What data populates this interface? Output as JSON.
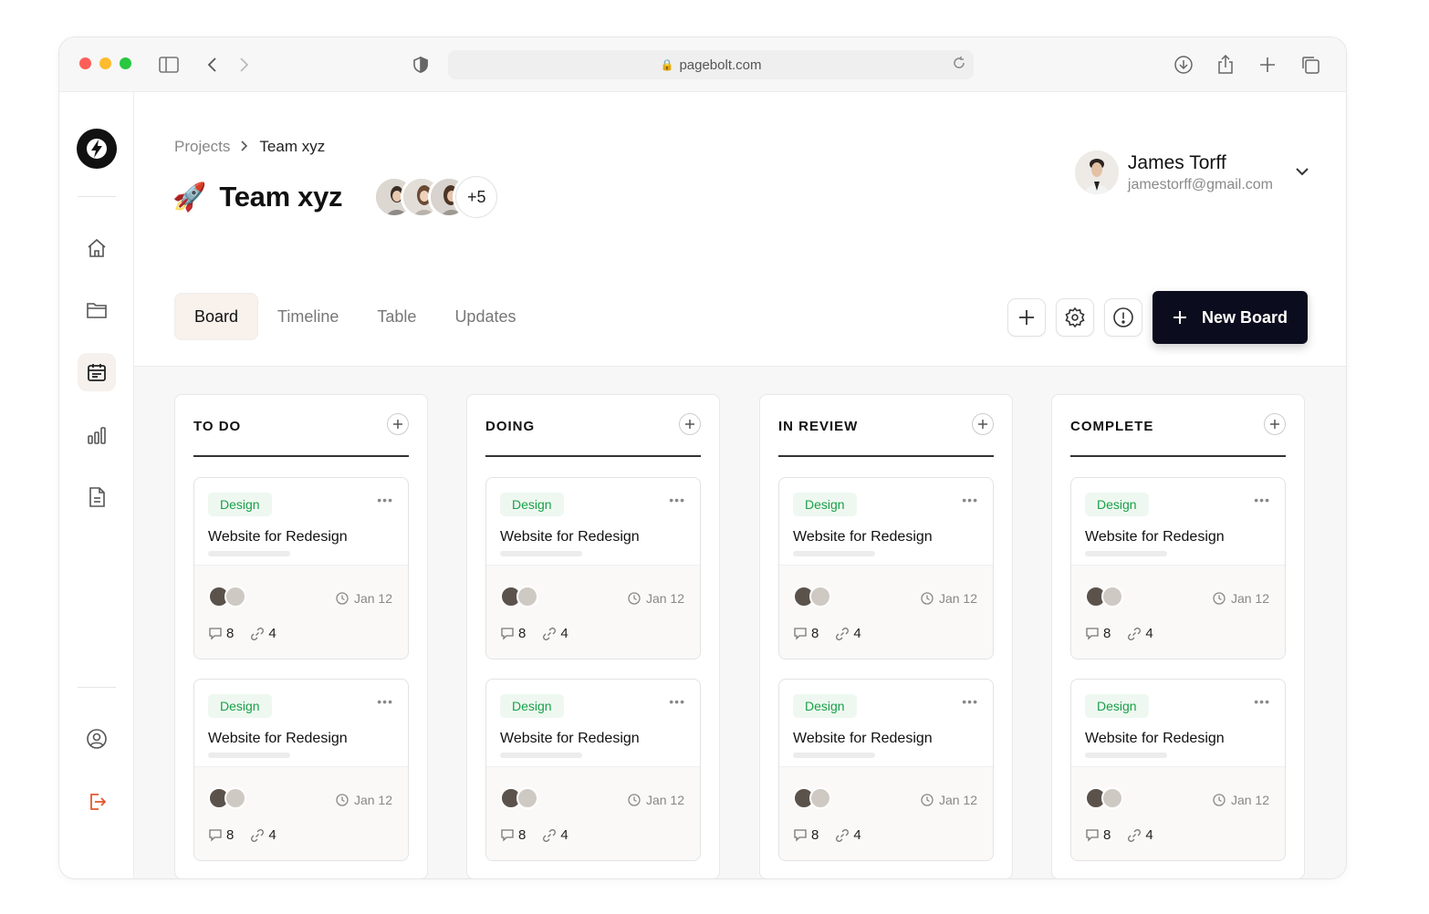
{
  "browser": {
    "url": "pagebolt.com"
  },
  "breadcrumb": {
    "parent": "Projects",
    "separator": ">",
    "current": "Team xyz"
  },
  "page": {
    "emoji": "🚀",
    "title": "Team xyz",
    "members_more": "+5"
  },
  "user": {
    "name": "James Torff",
    "email": "jamestorff@gmail.com"
  },
  "tabs": [
    "Board",
    "Timeline",
    "Table",
    "Updates"
  ],
  "toolbar": {
    "new_board_label": "New Board"
  },
  "columns": [
    {
      "title": "TO DO"
    },
    {
      "title": "DOING"
    },
    {
      "title": "IN REVIEW"
    },
    {
      "title": "COMPLETE"
    }
  ],
  "card": {
    "tag": "Design",
    "title": "Website for Redesign",
    "date": "Jan 12",
    "comments": "8",
    "attachments": "4",
    "tag_color": "#1aa04a"
  },
  "colors": {
    "accent_dark": "#0b0c1d",
    "logout_icon": "#e4572e"
  }
}
